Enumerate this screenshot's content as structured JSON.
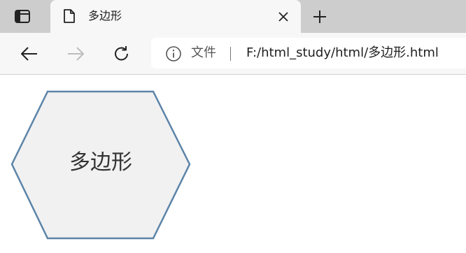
{
  "browser": {
    "tab": {
      "title": "多边形"
    },
    "address_bar": {
      "security_label": "文件",
      "url": "F:/html_study/html/多边形.html"
    },
    "icons": {
      "tab_actions": "tab-actions-icon",
      "page": "page-icon",
      "close": "close-icon",
      "new_tab": "plus-icon",
      "back": "back-arrow-icon",
      "forward": "forward-arrow-icon",
      "reload": "reload-icon",
      "info": "info-icon"
    }
  },
  "page": {
    "hexagon": {
      "label": "多边形",
      "fill": "#f1f1f1",
      "stroke": "#5c84a8"
    }
  }
}
